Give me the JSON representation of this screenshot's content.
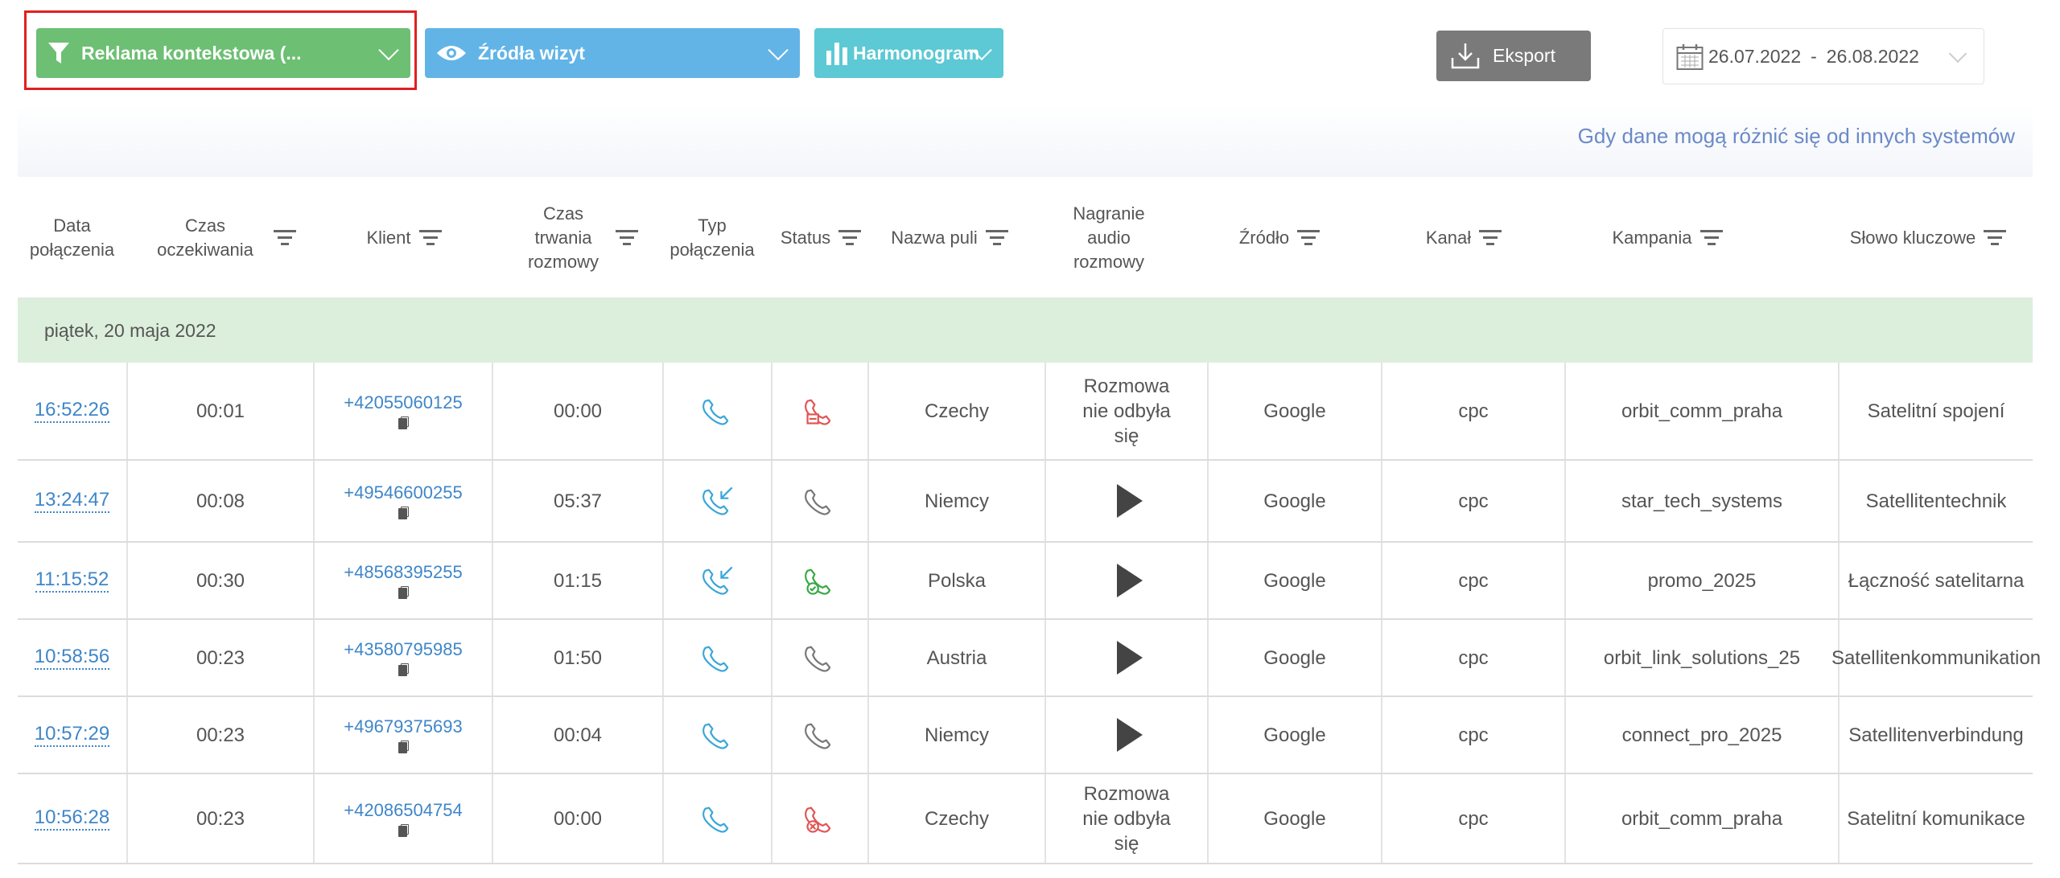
{
  "toolbar": {
    "filter_label": "Reklama kontekstowa (...",
    "sources_label": "Źródła wizyt",
    "schedule_label": "Harmonogram",
    "export_label": "Eksport",
    "date_from": "26.07.2022",
    "date_sep": "-",
    "date_to": "26.08.2022",
    "colors": {
      "filter": "#6dbf73",
      "sources": "#62b4e6",
      "schedule": "#5cc9d4",
      "export": "#7a7a7a",
      "highlight": "#e02020"
    }
  },
  "note": "Gdy dane mogą różnić się od innych systemów",
  "columns": [
    {
      "label": "Data połączenia"
    },
    {
      "label": "Czas oczekiwania"
    },
    {
      "label": "Klient"
    },
    {
      "label": "Czas trwania rozmowy"
    },
    {
      "label": "Typ połączenia"
    },
    {
      "label": "Status"
    },
    {
      "label": "Nazwa puli"
    },
    {
      "label": "Nagranie audio rozmowy"
    },
    {
      "label": "Źródło"
    },
    {
      "label": "Kanał"
    },
    {
      "label": "Kampania"
    },
    {
      "label": "Słowo kluczowe"
    }
  ],
  "group_label": "piątek, 20 maja 2022",
  "rows": [
    {
      "time": "16:52:26",
      "wait": "00:01",
      "phone": "+42055060125",
      "duration": "00:00",
      "type": "outgoing",
      "status": "failed-busy",
      "pool": "Czechy",
      "recording": "Rozmowa nie odbyła się",
      "source": "Google",
      "channel": "cpc",
      "campaign": "orbit_comm_praha",
      "keyword": "Satelitní spojení"
    },
    {
      "time": "13:24:47",
      "wait": "00:08",
      "phone": "+49546600255",
      "duration": "05:37",
      "type": "incoming",
      "status": "neutral",
      "pool": "Niemcy",
      "recording": "",
      "source": "Google",
      "channel": "cpc",
      "campaign": "star_tech_systems",
      "keyword": "Satellitentechnik"
    },
    {
      "time": "11:15:52",
      "wait": "00:30",
      "phone": "+48568395255",
      "duration": "01:15",
      "type": "incoming",
      "status": "answered",
      "pool": "Polska",
      "recording": "",
      "source": "Google",
      "channel": "cpc",
      "campaign": "promo_2025",
      "keyword": "Łączność satelitarna"
    },
    {
      "time": "10:58:56",
      "wait": "00:23",
      "phone": "+43580795985",
      "duration": "01:50",
      "type": "outgoing",
      "status": "neutral",
      "pool": "Austria",
      "recording": "",
      "source": "Google",
      "channel": "cpc",
      "campaign": "orbit_link_solutions_25",
      "keyword": "Satellitenkommunikation"
    },
    {
      "time": "10:57:29",
      "wait": "00:23",
      "phone": "+49679375693",
      "duration": "00:04",
      "type": "outgoing",
      "status": "neutral",
      "pool": "Niemcy",
      "recording": "",
      "source": "Google",
      "channel": "cpc",
      "campaign": "connect_pro_2025",
      "keyword": "Satellitenverbindung"
    },
    {
      "time": "10:56:28",
      "wait": "00:23",
      "phone": "+42086504754",
      "duration": "00:00",
      "type": "outgoing",
      "status": "failed",
      "pool": "Czechy",
      "recording": "Rozmowa nie odbyła się",
      "source": "Google",
      "channel": "cpc",
      "campaign": "orbit_comm_praha",
      "keyword": "Satelitní komunikace"
    }
  ],
  "icons": {
    "filter": "funnel-icon",
    "sources": "eye-icon",
    "schedule": "bar-chart-icon",
    "export": "download-icon",
    "date": "calendar-icon",
    "outgoing": "phone-outgoing-icon",
    "incoming": "phone-incoming-icon",
    "play": "play-icon",
    "copy": "copy-icon"
  },
  "status_colors": {
    "failed": "#e05555",
    "answered": "#3aa845",
    "neutral": "#777777",
    "type": "#3aa6d8"
  }
}
